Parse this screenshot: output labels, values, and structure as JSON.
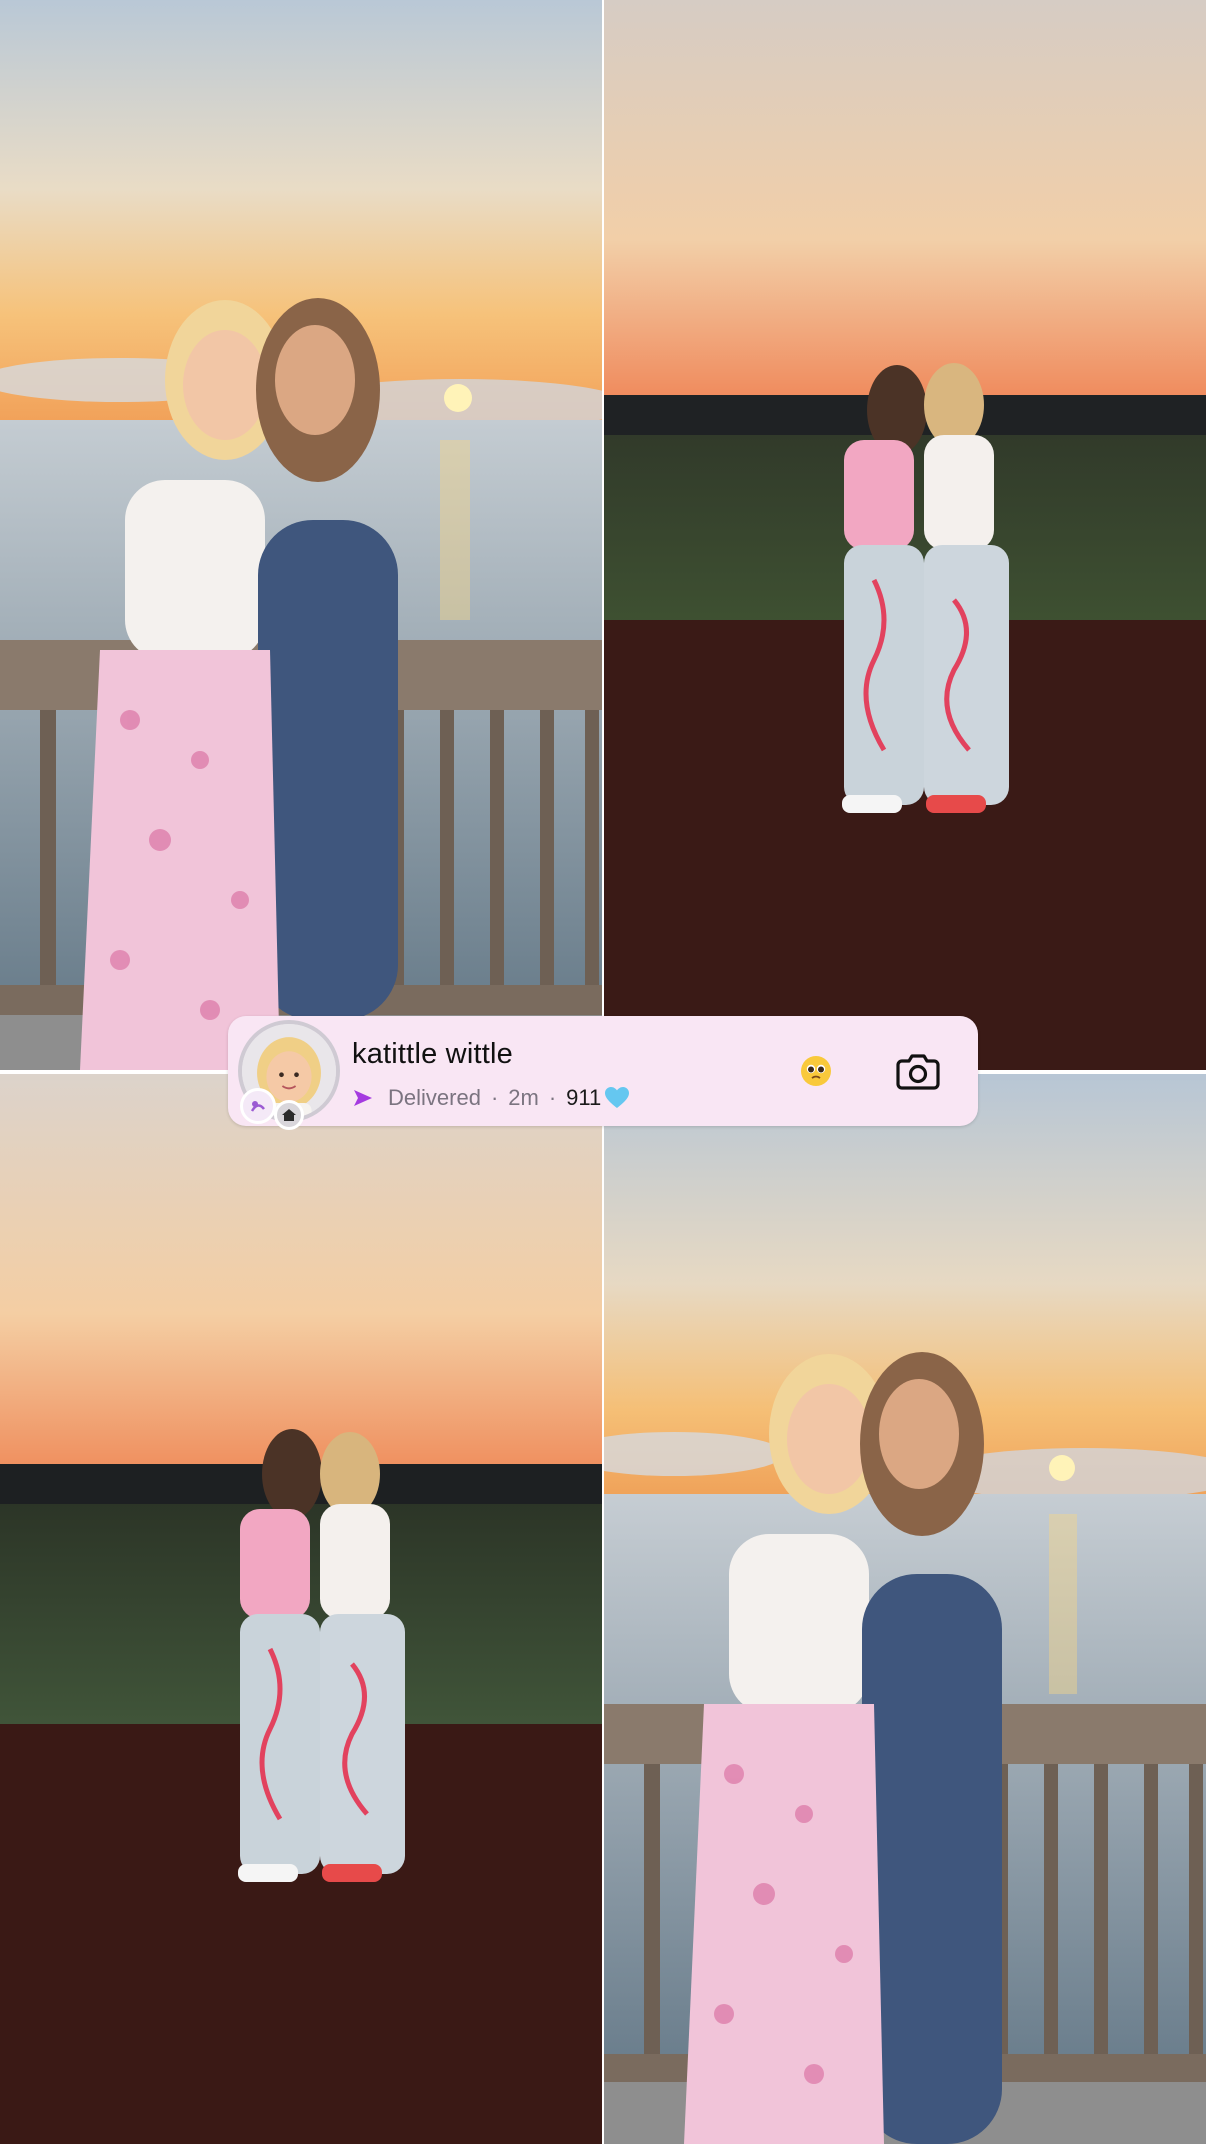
{
  "chat": {
    "name": "katittle wittle",
    "status": "Delivered",
    "time": "2m",
    "streak_count": "911",
    "streak_icon": "blue-heart-icon",
    "reaction_icon": "pleading-face-icon",
    "action_icon": "camera-icon"
  },
  "colors": {
    "bar_bg": "#f9e6f4",
    "delivered_arrow": "#a53ae0",
    "heart": "#65c7f0"
  }
}
